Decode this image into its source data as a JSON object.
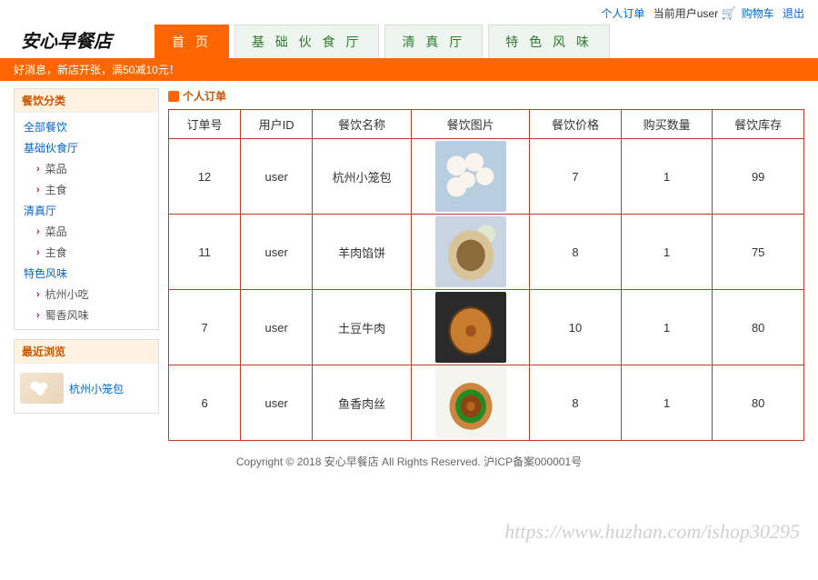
{
  "topbar": {
    "personal_orders": "个人订单",
    "current_user_label": "当前用户user",
    "cart": "购物车",
    "logout": "退出"
  },
  "logo": "安心早餐店",
  "nav": [
    {
      "label": "首 页",
      "active": true
    },
    {
      "label": "基 础 伙 食 厅",
      "active": false
    },
    {
      "label": "清 真 厅",
      "active": false
    },
    {
      "label": "特 色 风 味",
      "active": false
    }
  ],
  "announcement": "好消息，新店开张，满50减10元！",
  "sidebar": {
    "categories_title": "餐饮分类",
    "all": "全部餐饮",
    "groups": [
      {
        "name": "基础伙食厅",
        "items": [
          "菜品",
          "主食"
        ]
      },
      {
        "name": "清真厅",
        "items": [
          "菜品",
          "主食"
        ]
      },
      {
        "name": "特色风味",
        "items": [
          "杭州小吃",
          "蜀香风味"
        ]
      }
    ],
    "recent_title": "最近浏览",
    "recent": [
      {
        "name": "杭州小笼包"
      }
    ]
  },
  "content": {
    "title": "个人订单",
    "columns": [
      "订单号",
      "用户ID",
      "餐饮名称",
      "餐饮图片",
      "餐饮价格",
      "购买数量",
      "餐饮库存"
    ],
    "rows": [
      {
        "order_id": "12",
        "user_id": "user",
        "name": "杭州小笼包",
        "img": "baozi",
        "price": "7",
        "qty": "1",
        "stock": "99"
      },
      {
        "order_id": "11",
        "user_id": "user",
        "name": "羊肉馅饼",
        "img": "bing",
        "price": "8",
        "qty": "1",
        "stock": "75"
      },
      {
        "order_id": "7",
        "user_id": "user",
        "name": "土豆牛肉",
        "img": "tudou",
        "price": "10",
        "qty": "1",
        "stock": "80"
      },
      {
        "order_id": "6",
        "user_id": "user",
        "name": "鱼香肉丝",
        "img": "yuxiang",
        "price": "8",
        "qty": "1",
        "stock": "80"
      }
    ]
  },
  "footer": "Copyright © 2018 安心早餐店 All Rights Reserved. 沪ICP备案000001号",
  "watermark": "https://www.huzhan.com/ishop30295"
}
